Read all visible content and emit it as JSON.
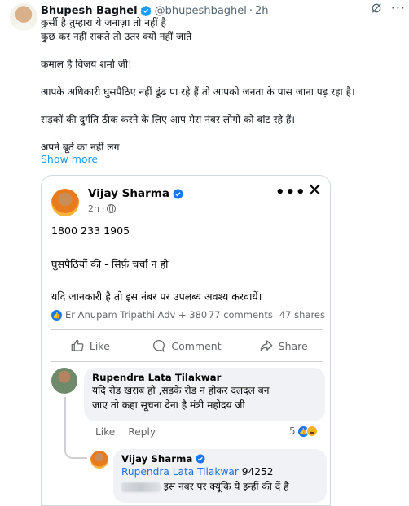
{
  "tweet": {
    "author_name": "Bhupesh Baghel",
    "handle": "@bhupeshbaghel",
    "separator": "·",
    "time": "2h",
    "lines": [
      "कुर्सी है तुम्हारा ये जनाज़ा तो नहीं है",
      "कुछ कर नहीं सकते तो उतर क्यों नहीं जाते",
      "",
      "कमाल है विजय शर्मा जी!",
      "",
      "आपके अधिकारी घुसपैठिए नहीं ढूंढ पा रहे हैं तो आपको जनता के पास जाना पड़ रहा है।",
      "",
      "सड़कों की दुर्गति ठीक करने के लिए  आप मेरा नंबर लोगों को बांट रहे हैं।",
      "",
      "अपने बूते का नहीं लग"
    ],
    "show_more": "Show more",
    "icons": {
      "grok": "grok-icon",
      "more": "more-icon",
      "verified": "verified-badge-icon"
    }
  },
  "post": {
    "author_name": "Vijay Sharma",
    "time": "2h",
    "meta_sep": "·",
    "more": "•••",
    "close": "✕",
    "lines": [
      "1800 233 1905",
      "घुसपैठियों की - सिर्फ़ चर्चा न हो",
      "यदि जानकारी है तो इस नंबर पर उपलब्ध अवश्य  करवायें।"
    ],
    "reactions_text": "Er Anupam Tripathi Adv + 380",
    "comments_count": "77 comments",
    "shares_count": "47 shares",
    "actions": {
      "like": "Like",
      "comment": "Comment",
      "share": "Share"
    }
  },
  "comments": [
    {
      "author": "Rupendra Lata Tilakwar",
      "lines": [
        "यदि रोड खराब हो ,सड़के रोड न होकर दलदल बन",
        "जाए तो कहा सूचना देना है मंत्री महोदय जी"
      ],
      "like": "Like",
      "reply": "Reply",
      "reaction_count": "5"
    }
  ],
  "reply": {
    "author": "Vijay Sharma",
    "mention": "Rupendra Lata Tilakwar",
    "number_visible": "94252",
    "text": " इस नंबर पर क्यूंकि ये इन्हीं की दें है"
  },
  "colors": {
    "link": "#1d9bf0",
    "fb_blue": "#1877f2",
    "mention": "#216fdb",
    "muted": "#65676b",
    "bubble": "#f0f2f5"
  }
}
